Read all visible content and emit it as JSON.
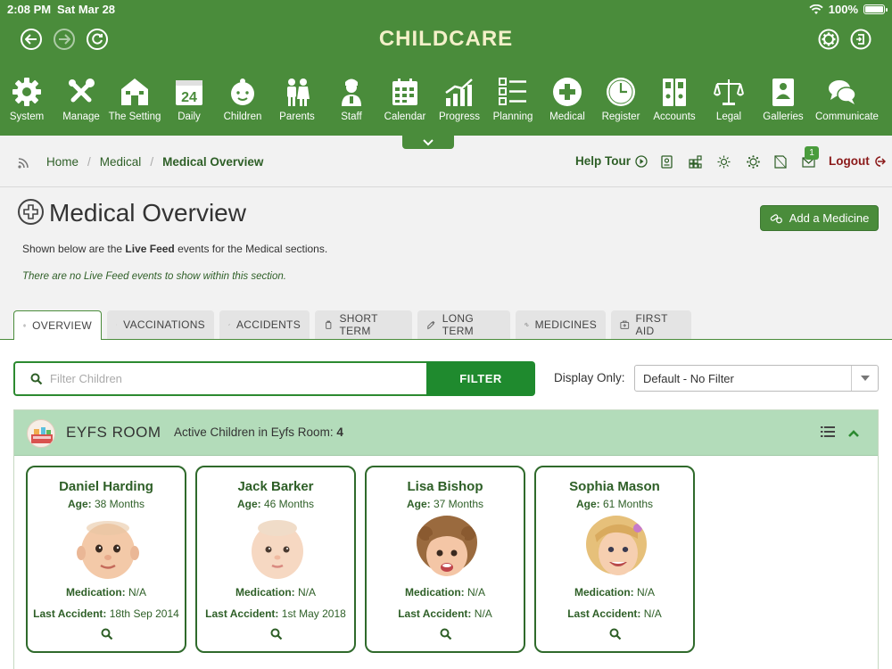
{
  "status": {
    "time": "2:08 PM",
    "date": "Sat Mar 28",
    "battery": "100%"
  },
  "brand": "CHILDCARE",
  "menu": [
    {
      "label": "System",
      "icon": "gear-icon"
    },
    {
      "label": "Manage",
      "icon": "tools-icon"
    },
    {
      "label": "The Setting",
      "icon": "house-icon"
    },
    {
      "label": "Daily",
      "icon": "calendar-day-icon"
    },
    {
      "label": "Children",
      "icon": "baby-icon"
    },
    {
      "label": "Parents",
      "icon": "parents-icon"
    },
    {
      "label": "Staff",
      "icon": "staff-icon"
    },
    {
      "label": "Calendar",
      "icon": "calendar-grid-icon"
    },
    {
      "label": "Progress",
      "icon": "chart-icon"
    },
    {
      "label": "Planning",
      "icon": "checklist-icon"
    },
    {
      "label": "Medical",
      "icon": "medical-cross-icon"
    },
    {
      "label": "Register",
      "icon": "clock-icon"
    },
    {
      "label": "Accounts",
      "icon": "binders-icon"
    },
    {
      "label": "Legal",
      "icon": "scales-icon"
    },
    {
      "label": "Galleries",
      "icon": "gallery-icon"
    },
    {
      "label": "Communicate",
      "icon": "chat-icon"
    }
  ],
  "breadcrumb": {
    "home": "Home",
    "section": "Medical",
    "current": "Medical Overview"
  },
  "help_tour": "Help Tour",
  "mail_badge": "1",
  "logout": "Logout",
  "page": {
    "title": "Medical Overview",
    "add_button": "Add a Medicine",
    "intro_prefix": "Shown below are the ",
    "intro_bold": "Live Feed",
    "intro_suffix": " events for the Medical sections.",
    "no_events": "There are no Live Feed events to show within this section."
  },
  "tabs": [
    {
      "label": "OVERVIEW",
      "active": true
    },
    {
      "label": "VACCINATIONS",
      "active": false
    },
    {
      "label": "ACCIDENTS",
      "active": false
    },
    {
      "label": "SHORT TERM",
      "active": false
    },
    {
      "label": "LONG TERM",
      "active": false
    },
    {
      "label": "MEDICINES",
      "active": false
    },
    {
      "label": "FIRST AID",
      "active": false
    }
  ],
  "filter": {
    "placeholder": "Filter Children",
    "button": "FILTER",
    "display_label": "Display Only:",
    "display_value": "Default - No Filter"
  },
  "room": {
    "name": "EYFS ROOM",
    "info_label": "Active Children in Eyfs Room:",
    "info_count": "4"
  },
  "labels": {
    "age": "Age:",
    "medication": "Medication:",
    "last_accident": "Last Accident:"
  },
  "children": [
    {
      "name": "Daniel Harding",
      "age": "38 Months",
      "medication": "N/A",
      "last_accident": "18th Sep 2014",
      "skin": "#f3c9a8",
      "hair": "#e8c6a4"
    },
    {
      "name": "Jack Barker",
      "age": "46 Months",
      "medication": "N/A",
      "last_accident": "1st May 2018",
      "skin": "#f6d8c2",
      "hair": "#f0dcc8"
    },
    {
      "name": "Lisa Bishop",
      "age": "37 Months",
      "medication": "N/A",
      "last_accident": "N/A",
      "skin": "#f4c6a6",
      "hair": "#9a6a3e"
    },
    {
      "name": "Sophia Mason",
      "age": "61 Months",
      "medication": "N/A",
      "last_accident": "N/A",
      "skin": "#f6cfb0",
      "hair": "#e6c07a"
    }
  ],
  "colors": {
    "header_green": "#4a8c3b",
    "dark_green": "#2e5f27",
    "filter_green": "#1f8a2e",
    "room_header": "#b3dcba",
    "logout_red": "#8b1a1a"
  }
}
